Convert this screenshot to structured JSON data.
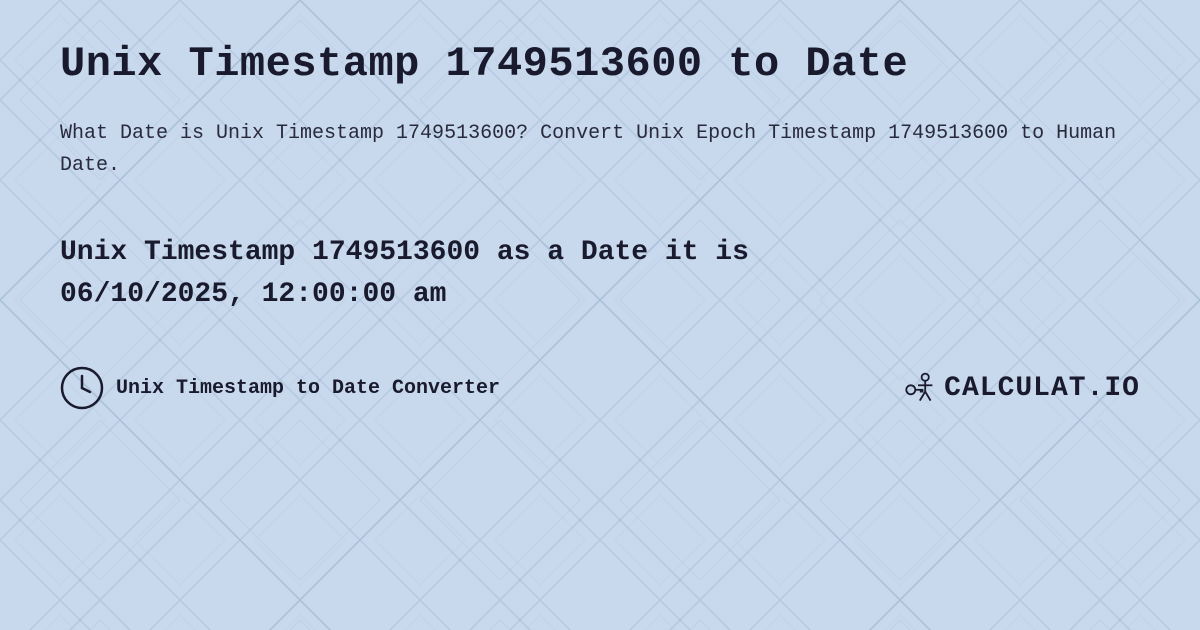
{
  "page": {
    "title": "Unix Timestamp 1749513600 to Date",
    "description": "What Date is Unix Timestamp 1749513600? Convert Unix Epoch Timestamp 1749513600 to Human Date.",
    "result_line1": "Unix Timestamp 1749513600 as a Date it is",
    "result_line2": "06/10/2025, 12:00:00 am",
    "footer_link": "Unix Timestamp to Date Converter",
    "logo_text": "CALCULAT.IO"
  },
  "colors": {
    "bg": "#c8d8ed",
    "text_dark": "#1a1a2e",
    "pattern_light": "#b8cce0",
    "pattern_lighter": "#d4e4f4"
  }
}
